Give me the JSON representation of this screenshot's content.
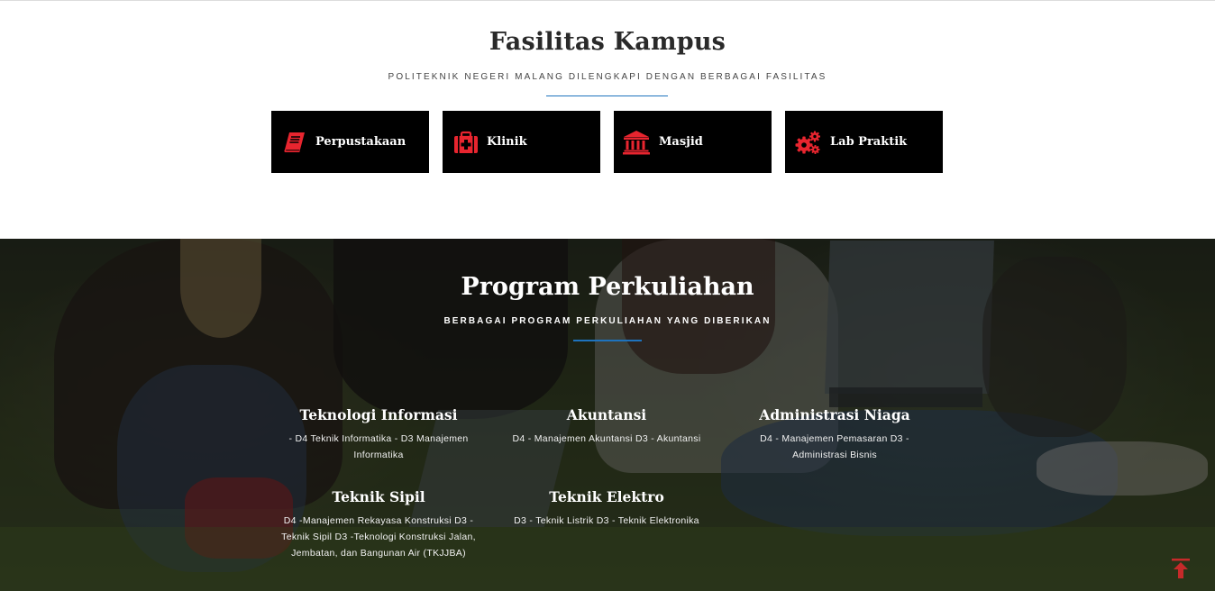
{
  "facilities": {
    "title": "Fasilitas Kampus",
    "subtitle": "POLITEKNIK NEGERI MALANG DILENGKAPI DENGAN BERBAGAI FASILITAS",
    "items": [
      {
        "label": "Perpustakaan",
        "icon": "book-icon"
      },
      {
        "label": "Klinik",
        "icon": "medkit-icon"
      },
      {
        "label": "Masjid",
        "icon": "institution-icon"
      },
      {
        "label": "Lab Praktik",
        "icon": "gears-icon"
      }
    ]
  },
  "programs": {
    "title": "Program Perkuliahan",
    "subtitle": "BERBAGAI PROGRAM PERKULIAHAN YANG DIBERIKAN",
    "courses": [
      {
        "name": "Teknologi Informasi",
        "desc": "- D4 Teknik Informatika - D3 Manajemen Informatika"
      },
      {
        "name": "Akuntansi",
        "desc": "D4 - Manajemen Akuntansi D3 - Akuntansi"
      },
      {
        "name": "Administrasi Niaga",
        "desc": "D4 - Manajemen Pemasaran D3 - Administrasi Bisnis"
      },
      {
        "name": "Teknik Sipil",
        "desc": "D4 -Manajemen Rekayasa Konstruksi D3 - Teknik Sipil D3 -Teknologi Konstruksi Jalan, Jembatan, dan Bangunan Air (TKJJBA)"
      },
      {
        "name": "Teknik Elektro",
        "desc": "D3 - Teknik Listrik D3 - Teknik Elektronika"
      }
    ]
  },
  "scroll_top": {
    "icon": "arrow-up-icon"
  },
  "colors": {
    "accent": "#e8252f",
    "divider": "#1e73be",
    "card_bg": "#000000"
  }
}
